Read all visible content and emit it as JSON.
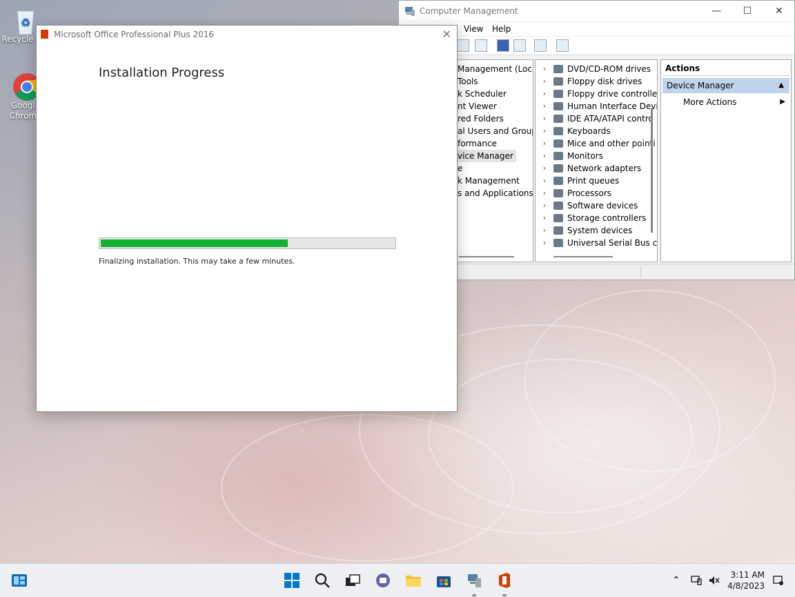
{
  "desktop": {
    "icons": [
      {
        "label": "Recycle Bin",
        "icon": "recycle-bin-icon"
      },
      {
        "label": "Google Chrome",
        "icon": "chrome-icon"
      }
    ]
  },
  "computer_management": {
    "title": "Computer Management",
    "controls": {
      "minimize": "—",
      "maximize": "☐",
      "close": "✕"
    },
    "menu": [
      "View",
      "Help"
    ],
    "tree": [
      "Management (Local",
      "Tools",
      "k Scheduler",
      "nt Viewer",
      "red Folders",
      "al Users and Groups",
      "formance",
      "vice Manager",
      "e",
      "k Management",
      "s and Applications"
    ],
    "tree_selected_index": 7,
    "devices": [
      "DVD/CD-ROM drives",
      "Floppy disk drives",
      "Floppy drive controlle",
      "Human Interface Devi",
      "IDE ATA/ATAPI contro",
      "Keyboards",
      "Mice and other pointi",
      "Monitors",
      "Network adapters",
      "Print queues",
      "Processors",
      "Software devices",
      "Storage controllers",
      "System devices",
      "Universal Serial Bus co"
    ],
    "actions": {
      "header": "Actions",
      "selected": "Device Manager",
      "more": "More Actions"
    }
  },
  "office_installer": {
    "title": "Microsoft Office Professional Plus 2016",
    "heading": "Installation Progress",
    "progress_fraction": 0.64,
    "status": "Finalizing installation. This may take a few minutes.",
    "colors": {
      "progress_fill": "#13b132",
      "logo": "#d83b01"
    }
  },
  "taskbar": {
    "time": "3:11 AM",
    "date": "4/8/2023",
    "apps": [
      "widgets-icon",
      "start-icon",
      "search-icon",
      "task-view-icon",
      "teams-chat-icon",
      "file-explorer-icon",
      "store-icon",
      "computer-management-icon",
      "office-icon"
    ]
  }
}
